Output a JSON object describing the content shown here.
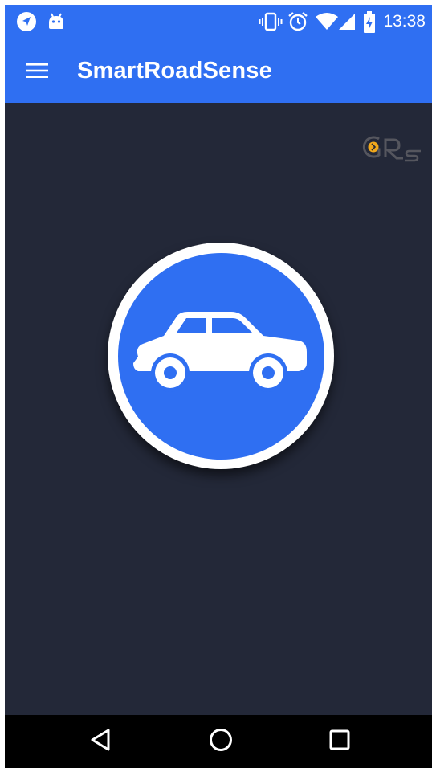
{
  "status_bar": {
    "time": "13:38",
    "left_icons": [
      "navigation-icon",
      "android-debug-icon"
    ],
    "right_icons": [
      "vibrate-icon",
      "alarm-icon",
      "wifi-icon",
      "cell-signal-icon",
      "battery-charging-icon"
    ]
  },
  "app_bar": {
    "title": "SmartRoadSense",
    "menu_icon": "hamburger-menu-icon"
  },
  "main": {
    "logo_icon": "srs-logo-icon",
    "vehicle_button_icon": "car-icon"
  },
  "nav_bar": {
    "buttons": [
      "back-icon",
      "home-icon",
      "recents-icon"
    ]
  },
  "colors": {
    "primary": "#2f6ff2",
    "background": "#232838",
    "nav_bar": "#000000",
    "logo_accent": "#f0a81c"
  }
}
